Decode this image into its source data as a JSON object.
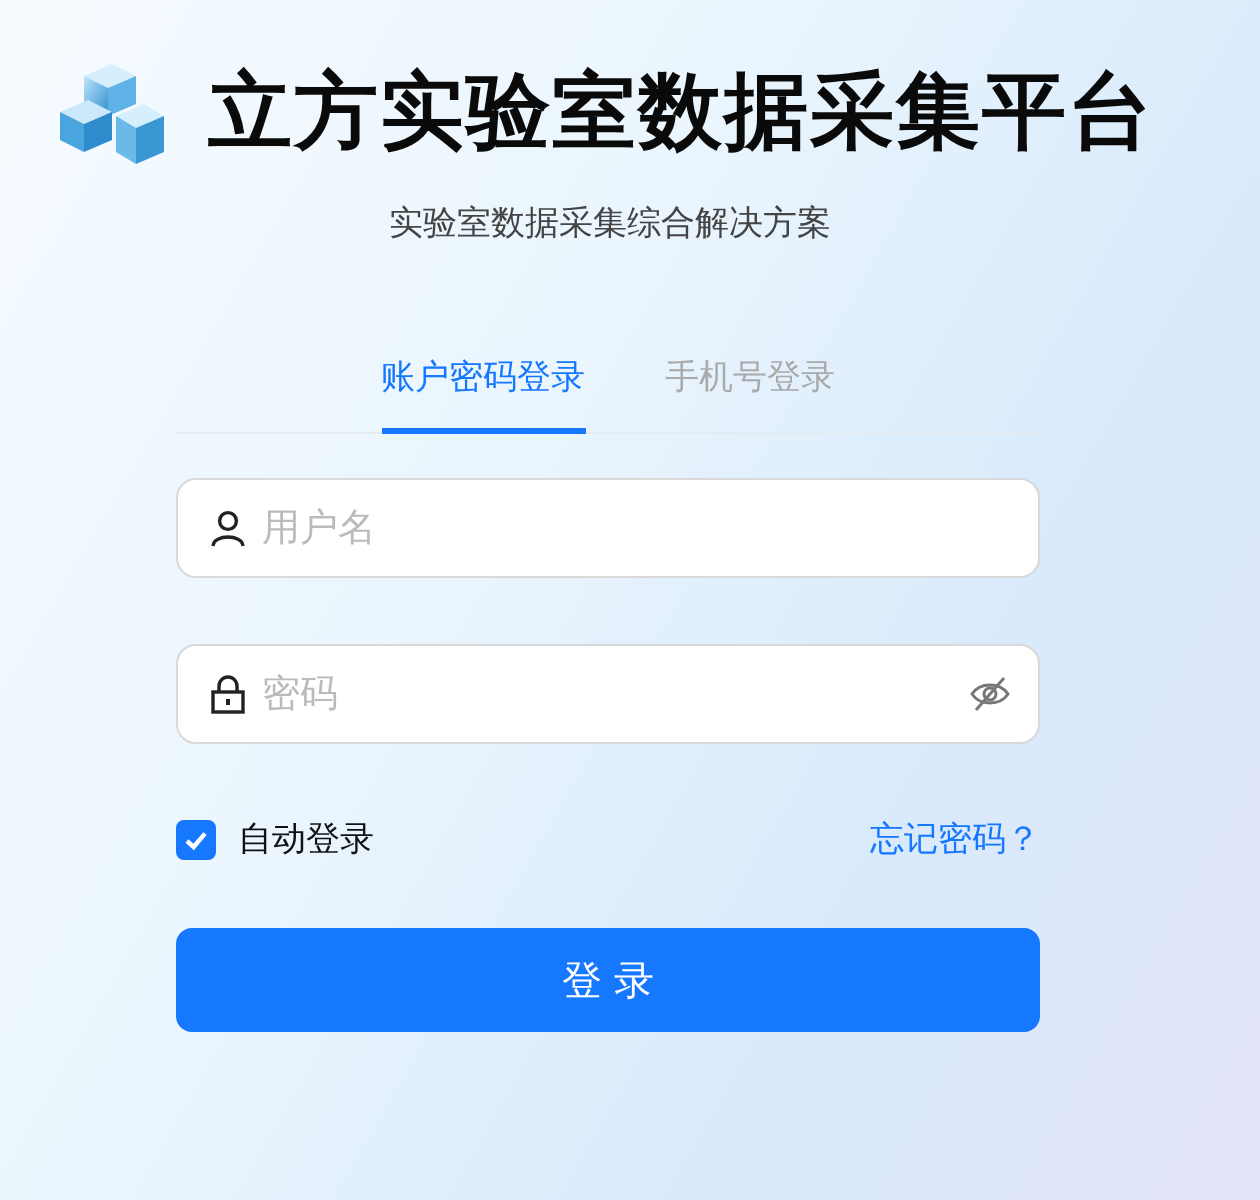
{
  "header": {
    "title": "立方实验室数据采集平台",
    "subtitle": "实验室数据采集综合解决方案"
  },
  "tabs": [
    {
      "label": "账户密码登录",
      "selected": true
    },
    {
      "label": "手机号登录",
      "selected": false
    }
  ],
  "username": {
    "placeholder": "用户名"
  },
  "password": {
    "placeholder": "密码"
  },
  "auto_login": {
    "label": "自动登录",
    "checked": true
  },
  "forgot_link": "忘记密码？",
  "login_button": "登 录"
}
